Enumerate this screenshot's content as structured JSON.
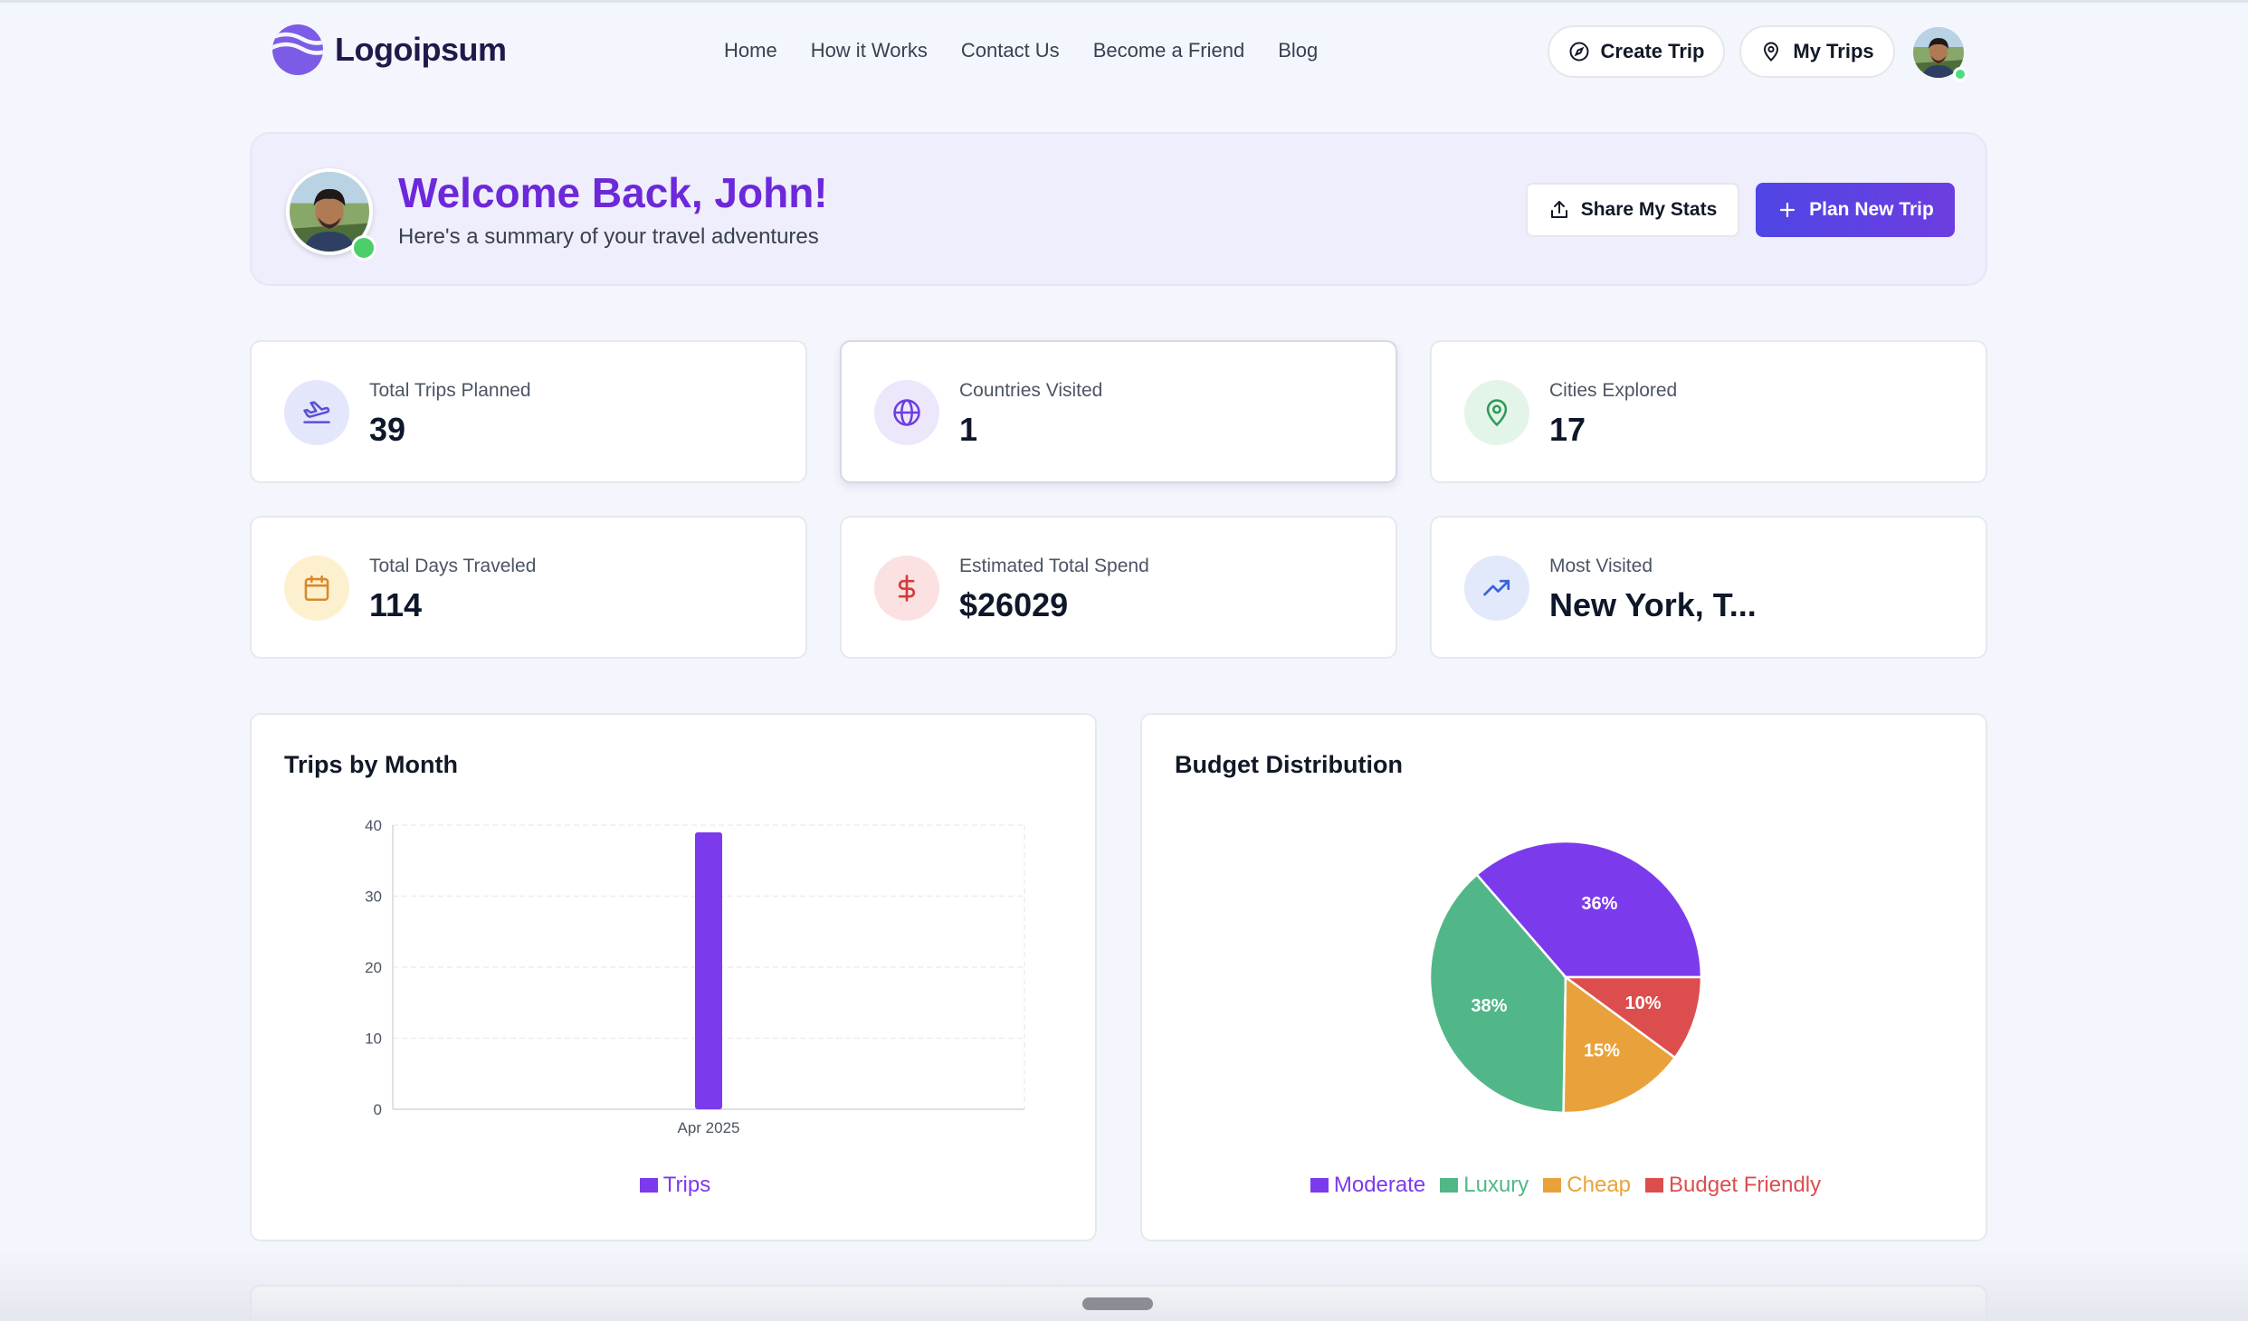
{
  "brand": {
    "name": "Logoipsum",
    "color": "#6d4fe0"
  },
  "nav": {
    "links": [
      "Home",
      "How it Works",
      "Contact Us",
      "Become a Friend",
      "Blog"
    ],
    "create_trip": "Create Trip",
    "my_trips": "My Trips"
  },
  "welcome": {
    "title": "Welcome Back, John!",
    "subtitle": "Here's a summary of your travel adventures",
    "share_label": "Share My Stats",
    "plan_label": "Plan New Trip"
  },
  "stats": [
    {
      "label": "Total Trips Planned",
      "value": "39",
      "icon": "plane-takeoff-icon"
    },
    {
      "label": "Countries Visited",
      "value": "1",
      "icon": "globe-icon"
    },
    {
      "label": "Cities Explored",
      "value": "17",
      "icon": "map-pin-icon"
    },
    {
      "label": "Total Days Traveled",
      "value": "114",
      "icon": "calendar-icon"
    },
    {
      "label": "Estimated Total Spend",
      "value": "$26029",
      "icon": "dollar-icon"
    },
    {
      "label": "Most Visited",
      "value": "New York, T...",
      "icon": "trending-up-icon"
    }
  ],
  "colors": {
    "accent": "#6d28d9",
    "primary": "#4f46e5",
    "moderate": "#7c3aed",
    "luxury": "#52b788",
    "cheap": "#e9a23b",
    "budget_friendly": "#dc4e4e"
  },
  "chart_data": [
    {
      "type": "bar",
      "title": "Trips by Month",
      "categories": [
        "Apr 2025"
      ],
      "series": [
        {
          "name": "Trips",
          "values": [
            39
          ],
          "color": "#7c3aed"
        }
      ],
      "ylim": [
        0,
        40
      ],
      "yticks": [
        0,
        10,
        20,
        30,
        40
      ],
      "grid": true,
      "legend": "bottom"
    },
    {
      "type": "pie",
      "title": "Budget Distribution",
      "categories": [
        "Moderate",
        "Luxury",
        "Cheap",
        "Budget Friendly"
      ],
      "values": [
        36,
        38,
        15,
        10
      ],
      "labels": [
        "36%",
        "38%",
        "15%",
        "10%"
      ],
      "colors": [
        "#7c3aed",
        "#52b788",
        "#e9a23b",
        "#dc4e4e"
      ],
      "legend": "bottom"
    }
  ]
}
